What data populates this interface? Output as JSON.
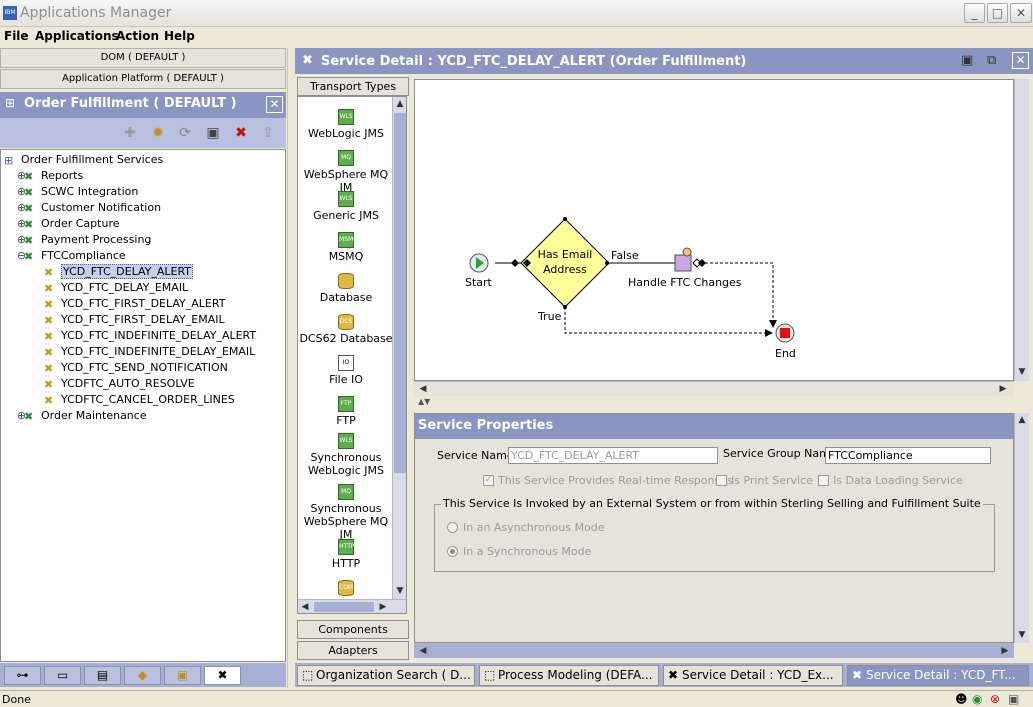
{
  "window": {
    "title": "Applications Manager",
    "app_icon_text": "IBM"
  },
  "menu": {
    "items": [
      "File",
      "Applications",
      "Action",
      "Help"
    ]
  },
  "left": {
    "bar1": "DOM ( DEFAULT )",
    "bar2": "Application Platform ( DEFAULT )",
    "panel_title": "Order Fulfillment ( DEFAULT )",
    "tree_root": "Order Fulfillment Services",
    "groups": [
      "Reports",
      "SCWC Integration",
      "Customer Notification",
      "Order Capture",
      "Payment Processing",
      "FTCCompliance"
    ],
    "ftc_children": [
      "YCD_FTC_DELAY_ALERT",
      "YCD_FTC_DELAY_EMAIL",
      "YCD_FTC_FIRST_DELAY_ALERT",
      "YCD_FTC_FIRST_DELAY_EMAIL",
      "YCD_FTC_INDEFINITE_DELAY_ALERT",
      "YCD_FTC_INDEFINITE_DELAY_EMAIL",
      "YCD_FTC_SEND_NOTIFICATION",
      "YCDFTC_AUTO_RESOLVE",
      "YCDFTC_CANCEL_ORDER_LINES"
    ],
    "last_group": "Order Maintenance",
    "selected": "YCD_FTC_DELAY_ALERT"
  },
  "main": {
    "title": "Service Detail : YCD_FTC_DELAY_ALERT (Order Fulfillment)"
  },
  "palette": {
    "header": "Transport Types",
    "items": [
      {
        "label": "WebLogic JMS",
        "icon": "WLS"
      },
      {
        "label": "WebSphere MQ JM",
        "icon": "MQ"
      },
      {
        "label": "Generic JMS",
        "icon": "WLS"
      },
      {
        "label": "MSMQ",
        "icon": "MSMQ"
      },
      {
        "label": "Database",
        "icon": ""
      },
      {
        "label": "DCS62 Database",
        "icon": "DCS"
      },
      {
        "label": "File IO",
        "icon": "IO"
      },
      {
        "label": "FTP",
        "icon": "FTP"
      },
      {
        "label": "Synchronous WebLogic JMS",
        "icon": "WLS"
      },
      {
        "label": "Synchronous WebSphere MQ JM",
        "icon": "MQ"
      },
      {
        "label": "HTTP",
        "icon": "HTTP"
      },
      {
        "label": "",
        "icon": "COM"
      }
    ],
    "components_btn": "Components",
    "adapters_btn": "Adapters"
  },
  "diagram": {
    "start_label": "Start",
    "decision_line1": "Has Email",
    "decision_line2": "Address",
    "false_label": "False",
    "true_label": "True",
    "task_label": "Handle FTC Changes",
    "end_label": "End"
  },
  "properties": {
    "header": "Service Properties",
    "service_name_label": "Service Name",
    "service_name_value": "YCD_FTC_DELAY_ALERT",
    "group_name_label": "Service Group Name",
    "group_name_value": "FTCCompliance",
    "cb_realtime": "This Service Provides Real-time Responses",
    "cb_print": "Is Print Service",
    "cb_dataload": "Is Data Loading Service",
    "invoked_legend": "This Service Is Invoked by an External System or from within Sterling Selling and Fulfillment Suite",
    "radio_async": "In an Asynchronous Mode",
    "radio_sync": "In a Synchronous Mode"
  },
  "bottom_tabs": [
    {
      "label": "Organization Search ( D...",
      "active": false
    },
    {
      "label": "Process Modeling (DEFA...",
      "active": false
    },
    {
      "label": "Service Detail : YCD_Ex...",
      "active": false
    },
    {
      "label": "Service Detail : YCD_FT...",
      "active": true
    }
  ],
  "status": {
    "text": "Done"
  }
}
